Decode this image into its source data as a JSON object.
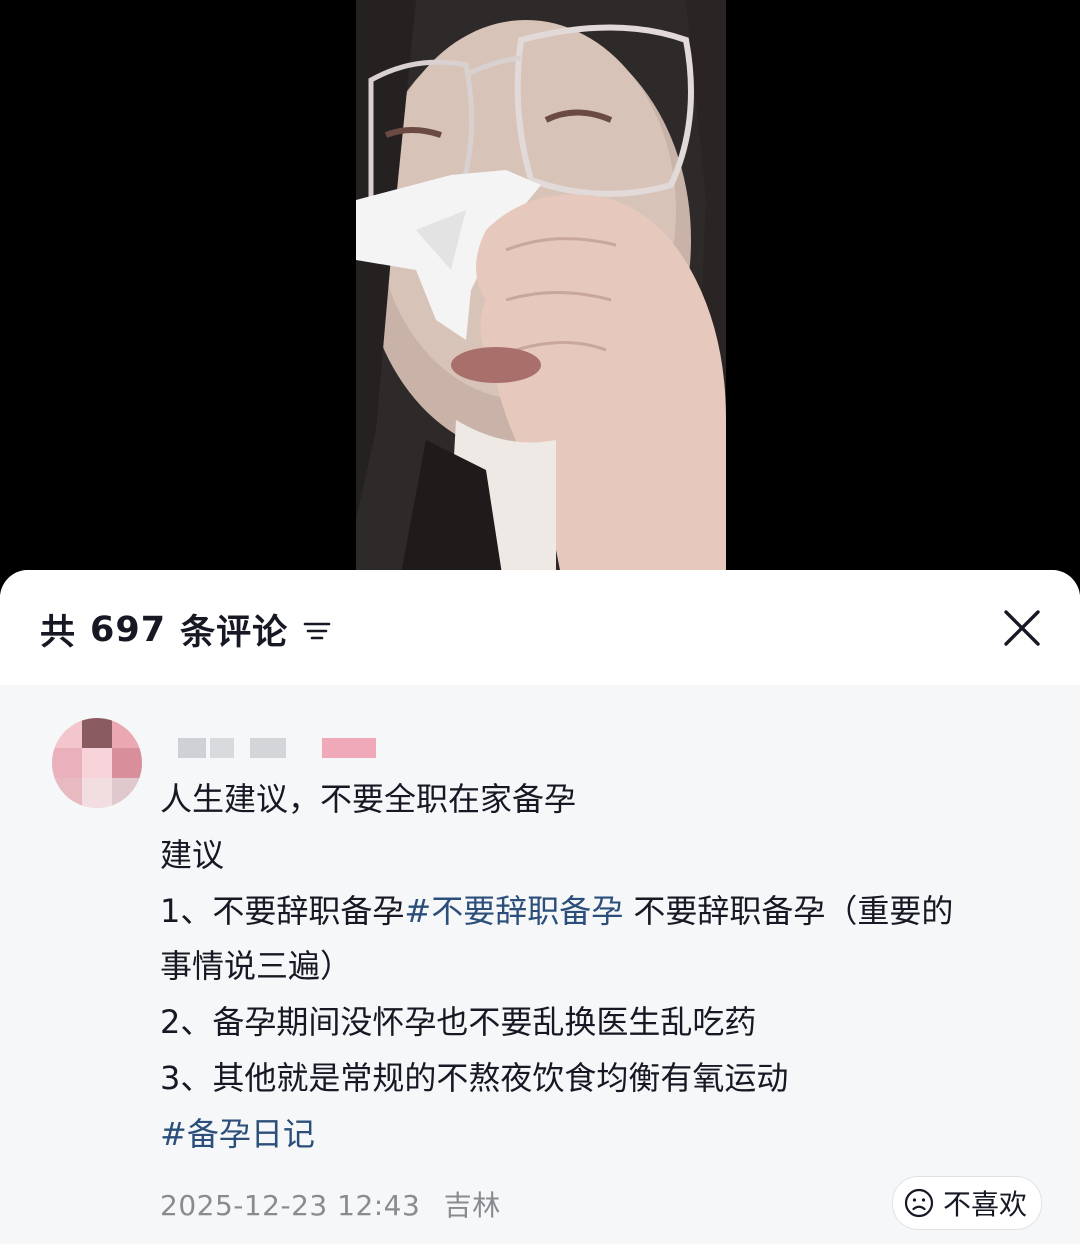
{
  "video": {
    "description_icon": "video-frame"
  },
  "comments_sheet": {
    "header": {
      "prefix": "共",
      "count": "697",
      "suffix": "条评论",
      "sort_icon": "sort-lines-icon",
      "close_icon": "close-x-icon"
    },
    "comment": {
      "avatar_icon": "blurred-avatar",
      "lines": [
        [
          {
            "text": "人生建议，不要全职在家备孕",
            "tag": false
          }
        ],
        [
          {
            "text": "建议",
            "tag": false
          }
        ],
        [
          {
            "text": "1、不要辞职备孕",
            "tag": false
          },
          {
            "text": "#不要辞职备孕",
            "tag": true
          },
          {
            "text": " 不要辞职备孕（重要的",
            "tag": false
          }
        ],
        [
          {
            "text": "事情说三遍）",
            "tag": false
          }
        ],
        [
          {
            "text": "2、备孕期间没怀孕也不要乱换医生乱吃药",
            "tag": false
          }
        ],
        [
          {
            "text": "3、其他就是常规的不熬夜饮食均衡有氧运动",
            "tag": false
          }
        ],
        [
          {
            "text": "#备孕日记",
            "tag": true
          }
        ]
      ],
      "date": "2025-12-23 12:43",
      "location": "吉林",
      "dislike_label": "不喜欢",
      "dislike_icon": "frown-face-icon"
    }
  },
  "colors": {
    "hashtag": "#2b4f7a",
    "meta": "#8a8b91",
    "text": "#161823",
    "sheet_bg": "#f6f7f9"
  }
}
